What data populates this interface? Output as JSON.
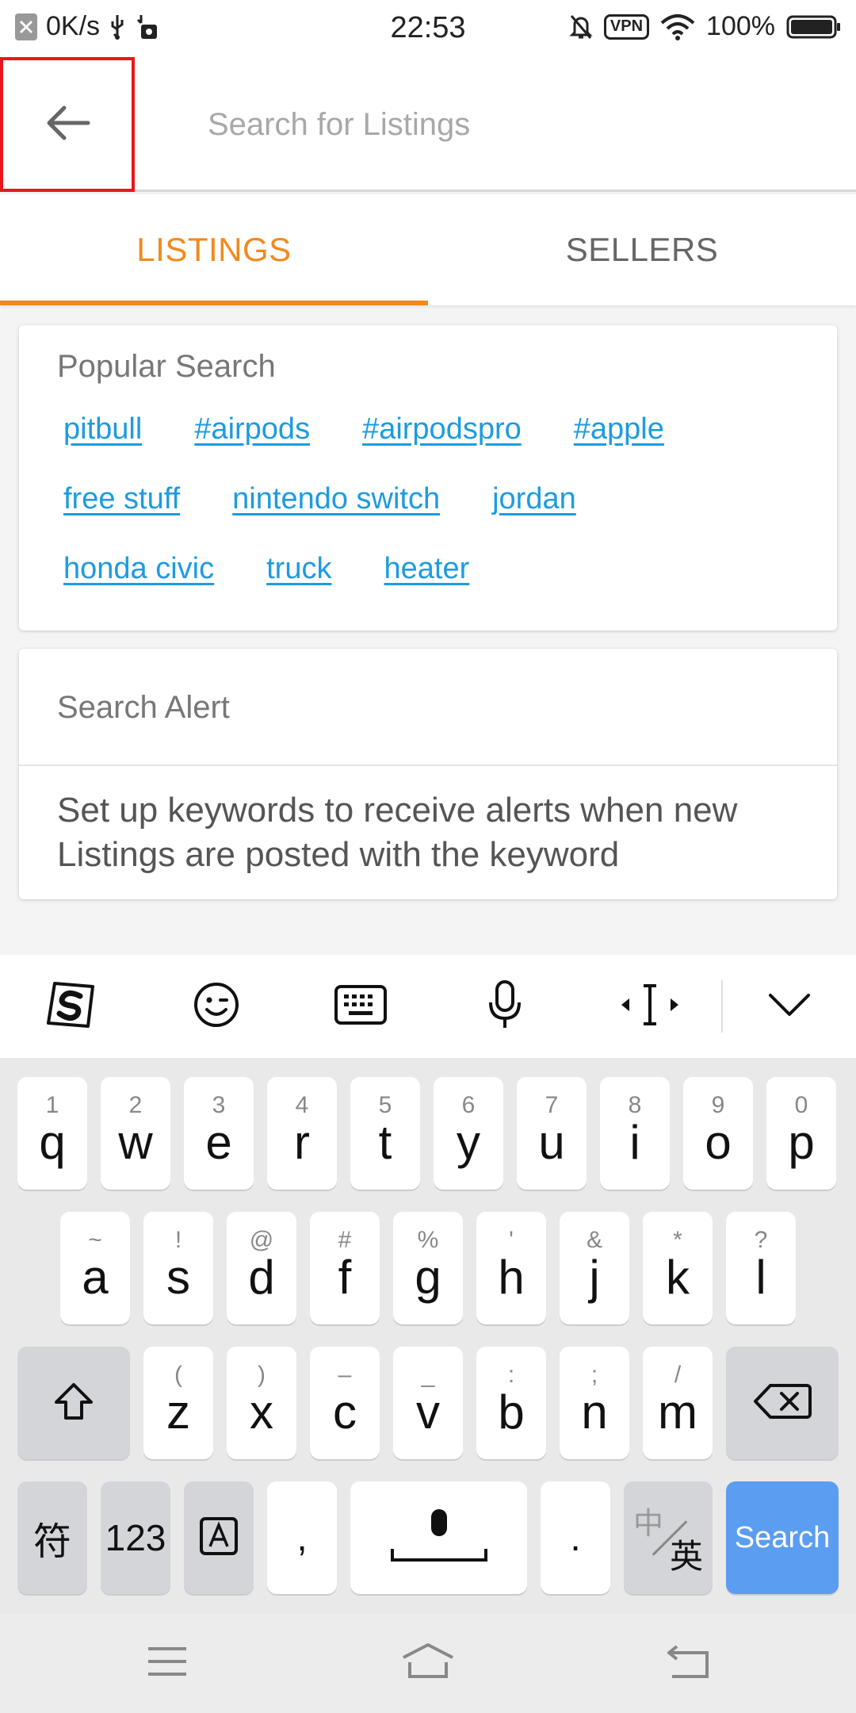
{
  "status_bar": {
    "speed": "0K/s",
    "time": "22:53",
    "vpn": "VPN",
    "battery": "100%"
  },
  "search": {
    "placeholder": "Search for Listings"
  },
  "tabs": [
    {
      "label": "LISTINGS",
      "active": true
    },
    {
      "label": "SELLERS",
      "active": false
    }
  ],
  "popular": {
    "title": "Popular Search",
    "rows": [
      [
        "pitbull",
        "#airpods",
        "#airpodspro",
        "#apple"
      ],
      [
        "free stuff",
        "nintendo switch",
        "jordan"
      ],
      [
        "honda civic",
        "truck",
        "heater"
      ]
    ]
  },
  "alert": {
    "title": "Search Alert",
    "body": "Set up keywords to receive alerts when new Listings are posted with the keyword"
  },
  "keyboard": {
    "row1": [
      {
        "hint": "1",
        "key": "q"
      },
      {
        "hint": "2",
        "key": "w"
      },
      {
        "hint": "3",
        "key": "e"
      },
      {
        "hint": "4",
        "key": "r"
      },
      {
        "hint": "5",
        "key": "t"
      },
      {
        "hint": "6",
        "key": "y"
      },
      {
        "hint": "7",
        "key": "u"
      },
      {
        "hint": "8",
        "key": "i"
      },
      {
        "hint": "9",
        "key": "o"
      },
      {
        "hint": "0",
        "key": "p"
      }
    ],
    "row2": [
      {
        "hint": "~",
        "key": "a"
      },
      {
        "hint": "!",
        "key": "s"
      },
      {
        "hint": "@",
        "key": "d"
      },
      {
        "hint": "#",
        "key": "f"
      },
      {
        "hint": "%",
        "key": "g"
      },
      {
        "hint": "'",
        "key": "h"
      },
      {
        "hint": "&",
        "key": "j"
      },
      {
        "hint": "*",
        "key": "k"
      },
      {
        "hint": "?",
        "key": "l"
      }
    ],
    "row3": [
      {
        "hint": "(",
        "key": "z"
      },
      {
        "hint": ")",
        "key": "x"
      },
      {
        "hint": "–",
        "key": "c"
      },
      {
        "hint": "_",
        "key": "v"
      },
      {
        "hint": ":",
        "key": "b"
      },
      {
        "hint": ";",
        "key": "n"
      },
      {
        "hint": "/",
        "key": "m"
      }
    ],
    "symbols_key": "符",
    "numbers_key": "123",
    "comma_key": ",",
    "period_key": ".",
    "lang_key_top": "中",
    "lang_key_bottom": "英",
    "search_key": "Search"
  },
  "colors": {
    "accent": "#f08a1e",
    "link": "#1d9be0",
    "search_key": "#5b9df0",
    "highlight_border": "#e8171c"
  }
}
